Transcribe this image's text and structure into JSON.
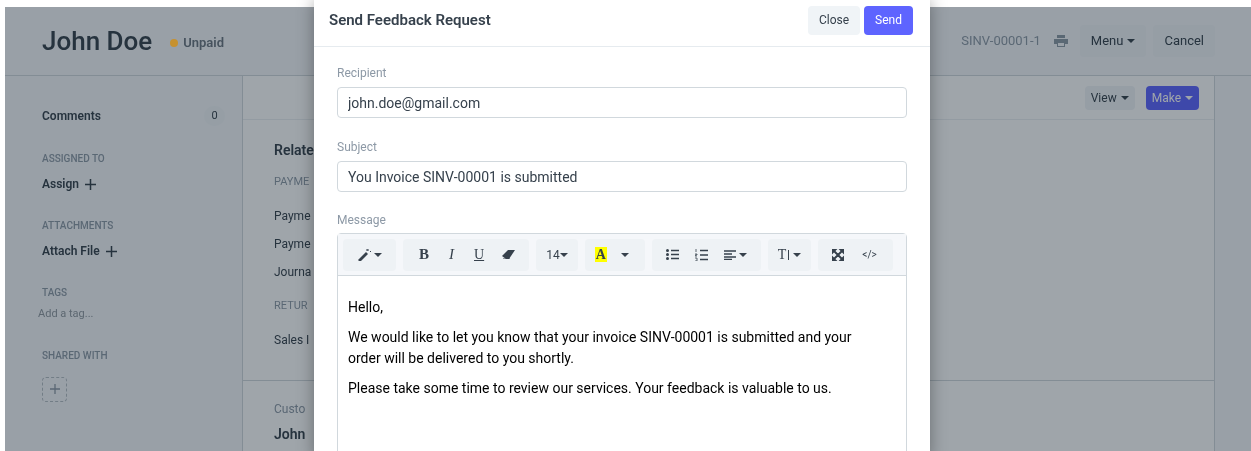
{
  "page": {
    "title": "John Doe",
    "status": {
      "label": "Unpaid",
      "color": "#c6912f"
    },
    "doc_id": "SINV-00001-1",
    "buttons": [
      "Menu",
      "Cancel"
    ]
  },
  "sidebar": {
    "comments": {
      "label": "Comments",
      "count": "0"
    },
    "sections": [
      {
        "heading": "ASSIGNED TO",
        "action": "Assign"
      },
      {
        "heading": "ATTACHMENTS",
        "action": "Attach File"
      },
      {
        "heading": "TAGS",
        "placeholder": "Add a tag..."
      },
      {
        "heading": "SHARED WITH"
      }
    ]
  },
  "toolbar": {
    "view": "View",
    "make": "Make"
  },
  "content": {
    "heading": "Relate",
    "groups": [
      {
        "heading": "PAYME",
        "links": [
          "Payme",
          "Payme",
          "Journa"
        ]
      },
      {
        "heading": "RETUR",
        "links": [
          "Sales I"
        ]
      }
    ],
    "field_label": "Custo",
    "field_value": "John"
  },
  "modal": {
    "title": "Send Feedback Request",
    "buttons": [
      "Close",
      "Send"
    ],
    "fields": [
      {
        "label": "Recipient",
        "value": "john.doe@gmail.com"
      },
      {
        "label": "Subject",
        "value": "You Invoice SINV-00001 is submitted"
      }
    ],
    "message_label": "Message",
    "editor_toolbar": [
      [
        {
          "kind": "magic"
        }
      ],
      [
        {
          "kind": "bold",
          "label": "B"
        },
        {
          "kind": "italic",
          "label": "I"
        },
        {
          "kind": "underline",
          "label": "U"
        },
        {
          "kind": "eraser"
        }
      ],
      [
        {
          "kind": "size",
          "label": "14"
        }
      ],
      [
        {
          "kind": "highlight",
          "label": "A"
        },
        {
          "kind": "caret"
        }
      ],
      [
        {
          "kind": "ul"
        },
        {
          "kind": "ol"
        },
        {
          "kind": "align"
        }
      ],
      [
        {
          "kind": "height",
          "label": "T"
        }
      ],
      [
        {
          "kind": "fullscreen"
        },
        {
          "kind": "code",
          "label": "</>"
        }
      ]
    ],
    "paragraphs": [
      "Hello,",
      "We would like to let you know that your invoice SINV-00001 is submitted and your order will be delivered to you shortly.",
      "Please take some time to review our services. Your feedback is valuable to us."
    ]
  }
}
